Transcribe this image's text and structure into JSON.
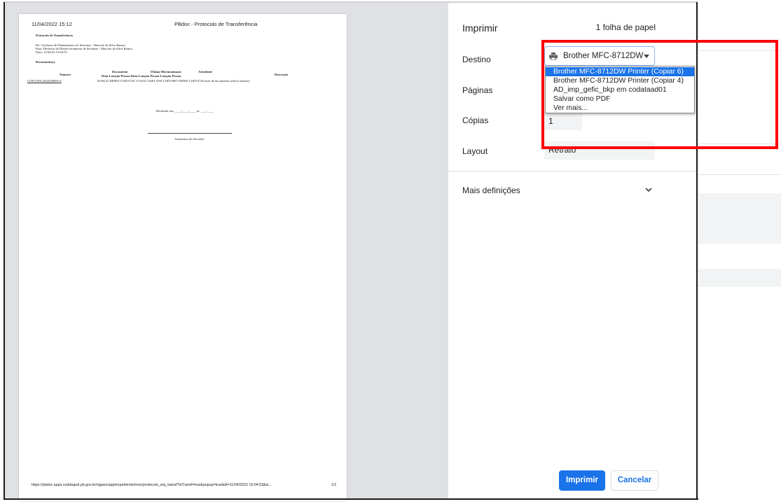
{
  "preview": {
    "header_date": "11/04/2022 15:12",
    "header_title": "PBdoc - Protocolo de Transferência",
    "section_title": "Protocolo de Transferência",
    "de_line": "De: Gerência de Planejamento de Sistemas - Marcelo da Silva Ramos",
    "para_line": "Para: Diretoria de Desenvolvimento de Sistemas - Marcelo da Silva Ramos",
    "data_line": "Data: 11/04/22 15:04:53",
    "documentos_label": "Documento(s)",
    "col_numero": "Número",
    "col_documento": "Documento",
    "col_ultima_mov": "Última Movimentação",
    "col_atendente": "Atendente",
    "col_descricao": "Descrição",
    "sub_cols": "Data   Lotação   Pessoa     Data   Lotação   Pessoa   Lotação   Pessoa",
    "row_numero": "COD-OFN-2022/00069-A",
    "row_values": "05/04/22  DIDES  COD15726 11/04/22  GEPLANS COD15687 DIDES  COD15726 teste de documento (ofício interno)",
    "recebido": "Recebido em: ____/____/____ às ____:____",
    "assinatura": "Assinatura do Servidor",
    "footer_url": "https://pbdoc.apps.codataprd.pb.gov.br/sigaex/app/expediente/mov/protocolo_arq_transf?isTransf=true&popup=true&dt=11/04/2022 15:04:53&si...",
    "page_num": "1/1"
  },
  "panel": {
    "title": "Imprimir",
    "sheets": "1 folha de papel",
    "destino_label": "Destino",
    "destino_value": "Brother MFC-8712DW",
    "paginas_label": "Páginas",
    "copias_label": "Cópias",
    "copias_value": "1",
    "layout_label": "Layout",
    "layout_value": "Retrato",
    "more_settings": "Mais definições",
    "print_button": "Imprimir",
    "cancel_button": "Cancelar"
  },
  "destination_dropdown": {
    "options": [
      "Brother MFC-8712DW Printer (Copiar 6)",
      "Brother MFC-8712DW Printer (Copiar 4)",
      "AD_imp_gefic_bkp em codataad01",
      "Salvar como PDF",
      "Ver mais..."
    ],
    "selected_index": 0
  },
  "colors": {
    "accent": "#1a73e8",
    "highlight_box": "#ff0000",
    "preview_background": "#dfe1e5"
  }
}
